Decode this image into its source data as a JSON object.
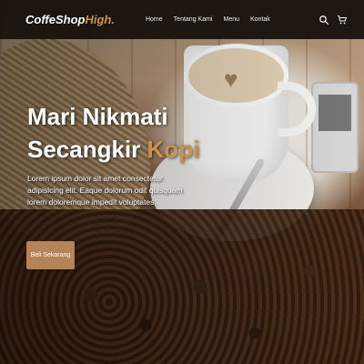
{
  "brand": {
    "name": "CoffeShop",
    "accent": "High."
  },
  "nav": {
    "items": [
      {
        "label": "Home"
      },
      {
        "label": "Tentang Kami"
      },
      {
        "label": "Menu"
      },
      {
        "label": "Kontak"
      }
    ],
    "icons": [
      "search-icon",
      "shopping-cart-icon"
    ]
  },
  "hero": {
    "title_line1": "Mari Nikmati",
    "title_line2_prefix": "Secangkir",
    "title_line2_accent": "Kopi",
    "description": "Lorem ipsum dolor sit amet consectetur adipisicing elit. Eaque dolorum odit quisquam lorem doloremque impedit voluptates.",
    "cta_label": "Beli Sekarang"
  },
  "colors": {
    "accent": "#c9924f",
    "navbar_bg": "#16100c",
    "button_bg": "#b58357",
    "text": "#ffffff"
  }
}
